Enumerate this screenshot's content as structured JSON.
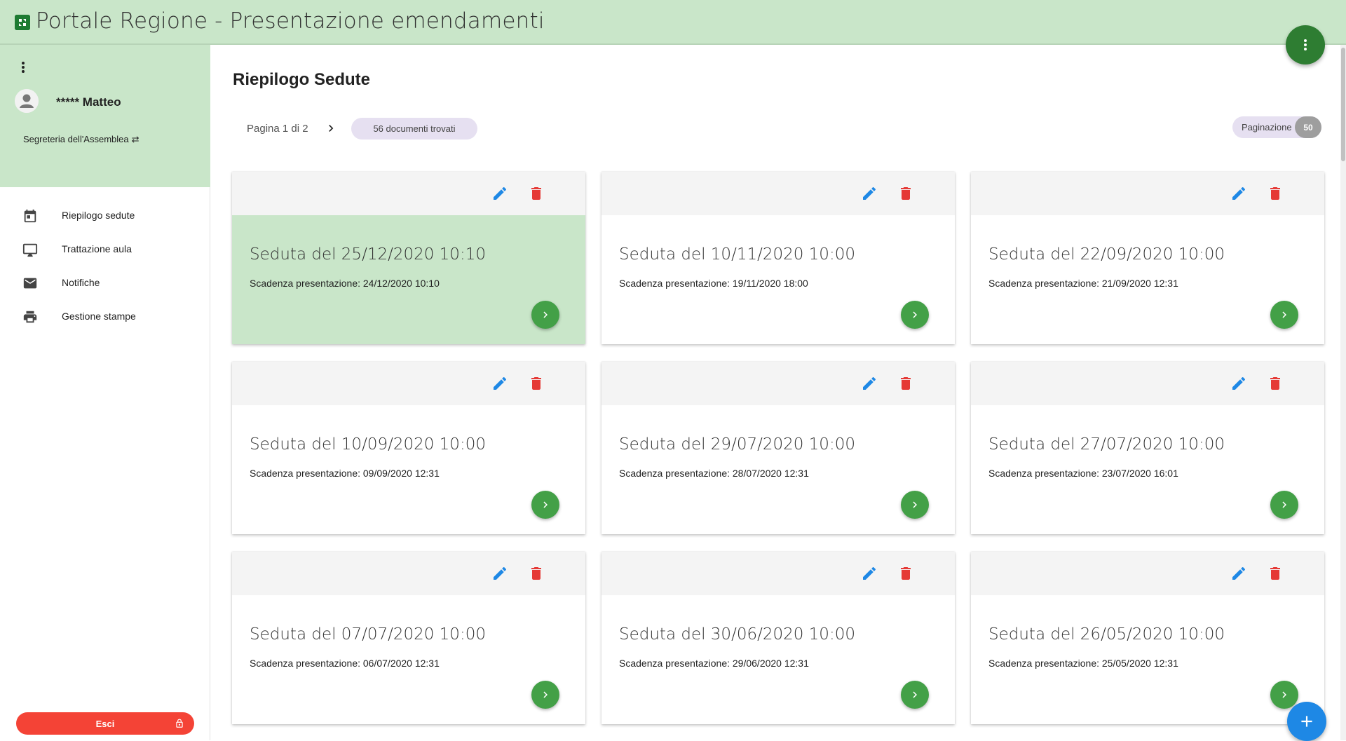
{
  "header": {
    "title": "Portale Regione - Presentazione emendamenti",
    "logo_icon": "region-logo-icon",
    "menu_icon": "more-vert-icon",
    "background": "#c9e6c9"
  },
  "sidebar": {
    "user_name": "***** Matteo",
    "user_role": "Segreteria dell'Assemblea",
    "role_switch_icon": "swap-icon",
    "items": [
      {
        "label": "Riepilogo sedute",
        "icon": "calendar-icon"
      },
      {
        "label": "Trattazione aula",
        "icon": "monitor-icon"
      },
      {
        "label": "Notifiche",
        "icon": "mail-icon"
      },
      {
        "label": "Gestione stampe",
        "icon": "printer-icon"
      }
    ],
    "logout_label": "Esci",
    "logout_color": "#f44336"
  },
  "main": {
    "title": "Riepilogo Sedute",
    "pagination_text": "Pagina 1 di 2",
    "documents_found": "56 documenti trovati",
    "page_size_label": "Paginazione",
    "page_size_value": "50"
  },
  "cards": [
    {
      "title": "Seduta del 25/12/2020 10:10",
      "deadline": "Scadenza presentazione: 24/12/2020 10:10",
      "selected": true
    },
    {
      "title": "Seduta del 10/11/2020 10:00",
      "deadline": "Scadenza presentazione: 19/11/2020 18:00",
      "selected": false
    },
    {
      "title": "Seduta del 22/09/2020 10:00",
      "deadline": "Scadenza presentazione: 21/09/2020 12:31",
      "selected": false
    },
    {
      "title": "Seduta del 10/09/2020 10:00",
      "deadline": "Scadenza presentazione: 09/09/2020 12:31",
      "selected": false
    },
    {
      "title": "Seduta del 29/07/2020 10:00",
      "deadline": "Scadenza presentazione: 28/07/2020 12:31",
      "selected": false
    },
    {
      "title": "Seduta del 27/07/2020 10:00",
      "deadline": "Scadenza presentazione: 23/07/2020 16:01",
      "selected": false
    },
    {
      "title": "Seduta del 07/07/2020 10:00",
      "deadline": "Scadenza presentazione: 06/07/2020 12:31",
      "selected": false
    },
    {
      "title": "Seduta del 30/06/2020 10:00",
      "deadline": "Scadenza presentazione: 29/06/2020 12:31",
      "selected": false
    },
    {
      "title": "Seduta del 26/05/2020 10:00",
      "deadline": "Scadenza presentazione: 25/05/2020 12:31",
      "selected": false
    }
  ],
  "colors": {
    "accent_green": "#43a047",
    "edit_blue": "#1e88e5",
    "delete_red": "#e53935",
    "chip_lavender": "#e6e0f1"
  }
}
